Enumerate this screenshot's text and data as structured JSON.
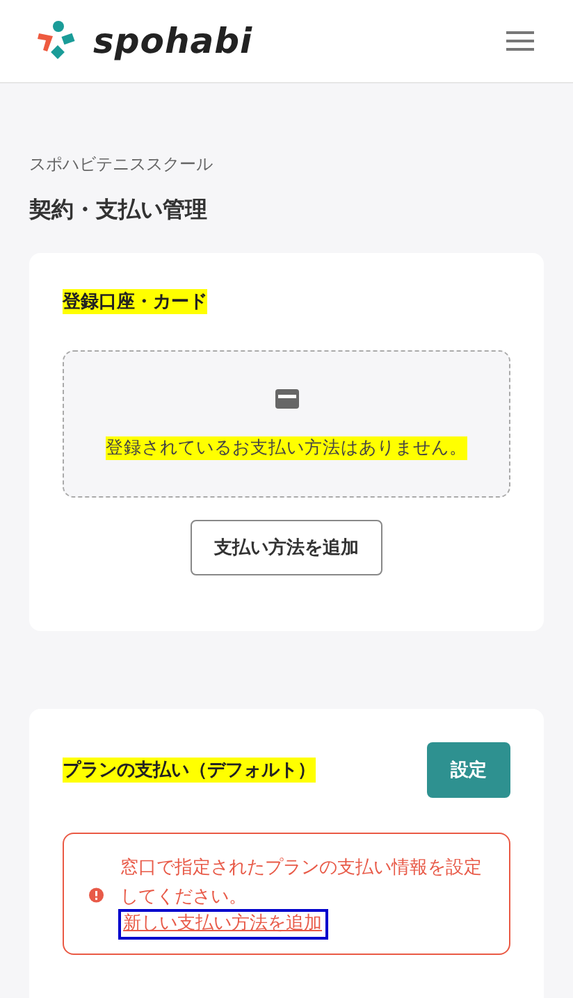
{
  "header": {
    "logo_text": "spohabi"
  },
  "school_name": "スポハビテニススクール",
  "page_title": "契約・支払い管理",
  "accounts_card": {
    "title": "登録口座・カード",
    "empty_message": "登録されているお支払い方法はありません。",
    "add_button": "支払い方法を追加"
  },
  "plan_card": {
    "title": "プランの支払い（デフォルト）",
    "set_button": "設定",
    "alert": {
      "message": "窓口で指定されたプランの支払い情報を設定してください。",
      "link": "新しい支払い方法を追加",
      "link_focused": true
    }
  }
}
